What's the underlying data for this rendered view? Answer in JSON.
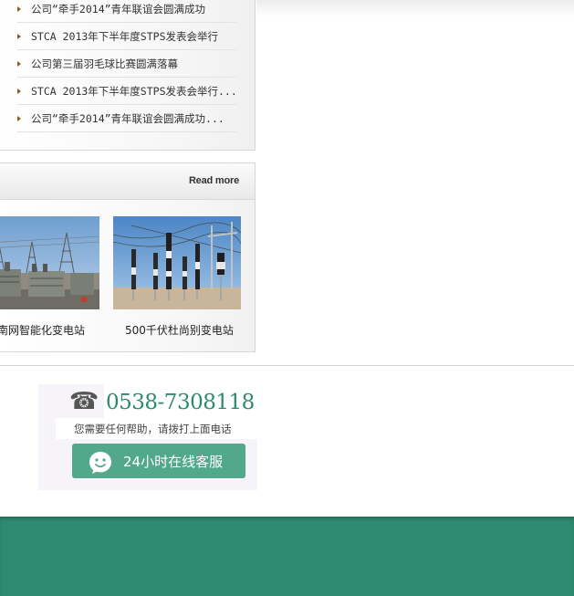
{
  "news": {
    "items": [
      "公司“牵手2014”青年联谊会圆满成功",
      "STCA 2013年下半年度STPS发表会举行",
      "公司第三届羽毛球比赛圆满落幕",
      "STCA 2013年下半年度STPS发表会举行...",
      "公司“牵手2014”青年联谊会圆满成功..."
    ]
  },
  "projects": {
    "read_more": "Read more",
    "items": [
      {
        "caption": "南网智能化变电站",
        "image": "substation-transformer-photo"
      },
      {
        "caption": "500千伏杜尚别变电站",
        "image": "substation-insulators-photo"
      }
    ]
  },
  "contact": {
    "phone_icon": "phone-icon",
    "phone": "0538-7308118",
    "help": "您需要任何帮助，请拨打上面电话",
    "service_label": "24小时在线客服",
    "accent": "#2e8a6d",
    "button_color": "#52a88a"
  },
  "footer": {
    "color": "#2e8a70"
  }
}
